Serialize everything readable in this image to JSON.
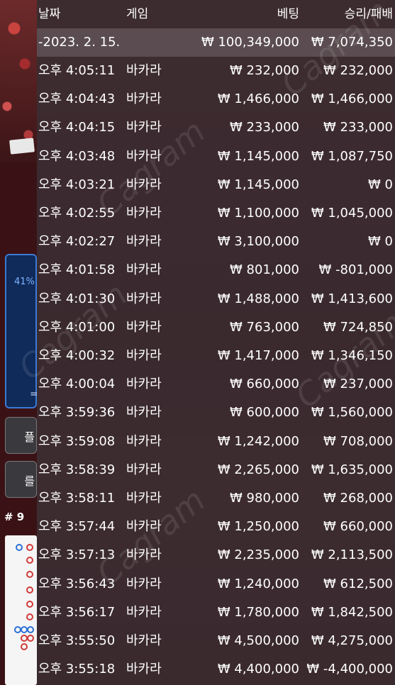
{
  "header": {
    "date_label": "날짜",
    "game_label": "게임",
    "bet_label": "베팅",
    "result_label": "승리/패배"
  },
  "summary": {
    "date": "-2023. 2. 15.",
    "total_bet": "₩ 100,349,000",
    "total_result": "₩ 7,074,350"
  },
  "rows": [
    {
      "time": "오후 4:05:11",
      "game": "바카라",
      "bet": "₩ 232,000",
      "result": "₩ 232,000"
    },
    {
      "time": "오후 4:04:43",
      "game": "바카라",
      "bet": "₩ 1,466,000",
      "result": "₩ 1,466,000"
    },
    {
      "time": "오후 4:04:15",
      "game": "바카라",
      "bet": "₩ 233,000",
      "result": "₩ 233,000"
    },
    {
      "time": "오후 4:03:48",
      "game": "바카라",
      "bet": "₩ 1,145,000",
      "result": "₩ 1,087,750"
    },
    {
      "time": "오후 4:03:21",
      "game": "바카라",
      "bet": "₩ 1,145,000",
      "result": "₩ 0"
    },
    {
      "time": "오후 4:02:55",
      "game": "바카라",
      "bet": "₩ 1,100,000",
      "result": "₩ 1,045,000"
    },
    {
      "time": "오후 4:02:27",
      "game": "바카라",
      "bet": "₩ 3,100,000",
      "result": "₩ 0"
    },
    {
      "time": "오후 4:01:58",
      "game": "바카라",
      "bet": "₩ 801,000",
      "result": "₩ -801,000"
    },
    {
      "time": "오후 4:01:30",
      "game": "바카라",
      "bet": "₩ 1,488,000",
      "result": "₩ 1,413,600"
    },
    {
      "time": "오후 4:01:00",
      "game": "바카라",
      "bet": "₩ 763,000",
      "result": "₩ 724,850"
    },
    {
      "time": "오후 4:00:32",
      "game": "바카라",
      "bet": "₩ 1,417,000",
      "result": "₩ 1,346,150"
    },
    {
      "time": "오후 4:00:04",
      "game": "바카라",
      "bet": "₩ 660,000",
      "result": "₩ 237,000"
    },
    {
      "time": "오후 3:59:36",
      "game": "바카라",
      "bet": "₩ 600,000",
      "result": "₩ 1,560,000"
    },
    {
      "time": "오후 3:59:08",
      "game": "바카라",
      "bet": "₩ 1,242,000",
      "result": "₩ 708,000"
    },
    {
      "time": "오후 3:58:39",
      "game": "바카라",
      "bet": "₩ 2,265,000",
      "result": "₩ 1,635,000"
    },
    {
      "time": "오후 3:58:11",
      "game": "바카라",
      "bet": "₩ 980,000",
      "result": "₩ 268,000"
    },
    {
      "time": "오후 3:57:44",
      "game": "바카라",
      "bet": "₩ 1,250,000",
      "result": "₩ 660,000"
    },
    {
      "time": "오후 3:57:13",
      "game": "바카라",
      "bet": "₩ 2,235,000",
      "result": "₩ 2,113,500"
    },
    {
      "time": "오후 3:56:43",
      "game": "바카라",
      "bet": "₩ 1,240,000",
      "result": "₩ 612,500"
    },
    {
      "time": "오후 3:56:17",
      "game": "바카라",
      "bet": "₩ 1,780,000",
      "result": "₩ 1,842,500"
    },
    {
      "time": "오후 3:55:50",
      "game": "바카라",
      "bet": "₩ 4,500,000",
      "result": "₩ 4,275,000"
    },
    {
      "time": "오후 3:55:18",
      "game": "바카라",
      "bet": "₩ 4,400,000",
      "result": "₩ -4,400,000"
    }
  ],
  "side": {
    "stat_percent": "41%",
    "stat_char": "=",
    "button1_label": "플",
    "button2_label": "를",
    "shoe_label": "# 9"
  },
  "watermark": "Cagram",
  "colors": {
    "overlay": "#3a2c30",
    "summary_row": "#5a4c50",
    "text": "#ffffff",
    "stat_blue": "#3a7bd5"
  }
}
